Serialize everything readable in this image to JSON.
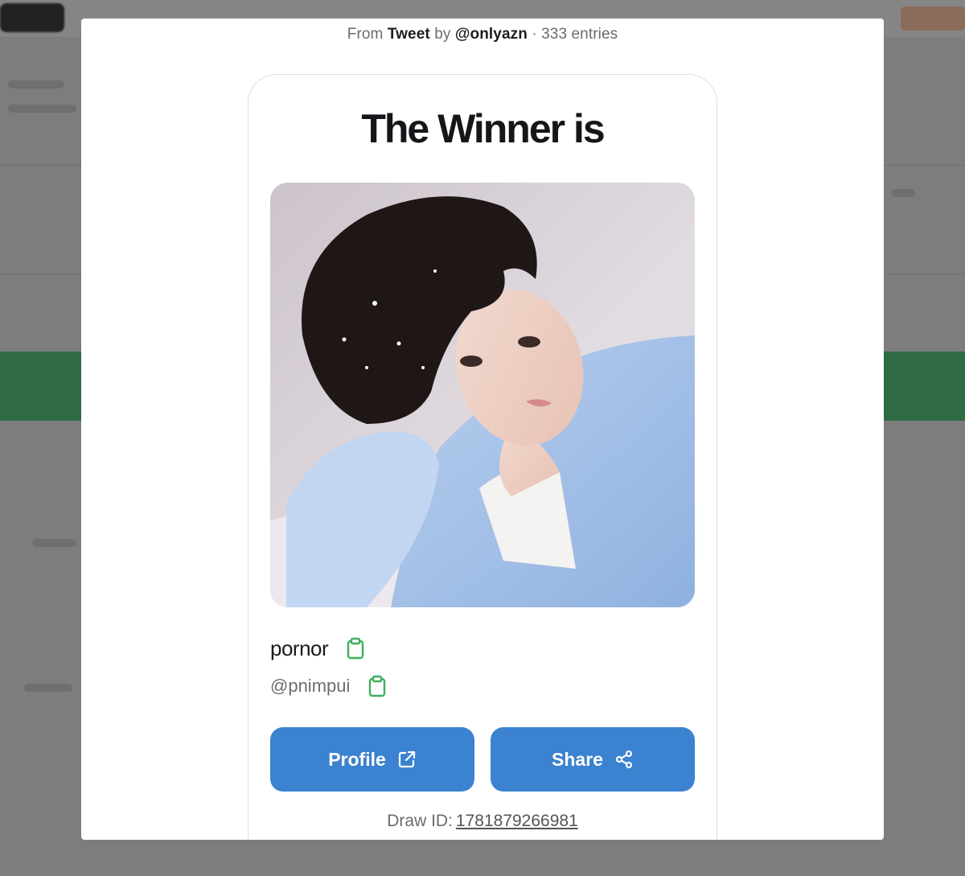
{
  "source": {
    "prefix": "From",
    "platform": "Tweet",
    "by_label": "by",
    "author": "@onlyazn",
    "separator": "·",
    "entries": "333 entries"
  },
  "card": {
    "title": "The Winner is",
    "winner_name": "pornor",
    "winner_handle": "@pnimpui",
    "photo_alt": "winner-avatar",
    "profile_button": "Profile",
    "share_button": "Share",
    "draw_id_label": "Draw ID:",
    "draw_id_value": "1781879266981"
  },
  "icons": {
    "copy_name": "clipboard-icon",
    "copy_handle": "clipboard-icon",
    "profile": "external-link-icon",
    "share": "share-icon"
  },
  "colors": {
    "primary_button": "#3b82d0",
    "clipboard_icon": "#3fae5f",
    "overlay": "#7d7d7d",
    "background_accent": "#2f6b43"
  }
}
